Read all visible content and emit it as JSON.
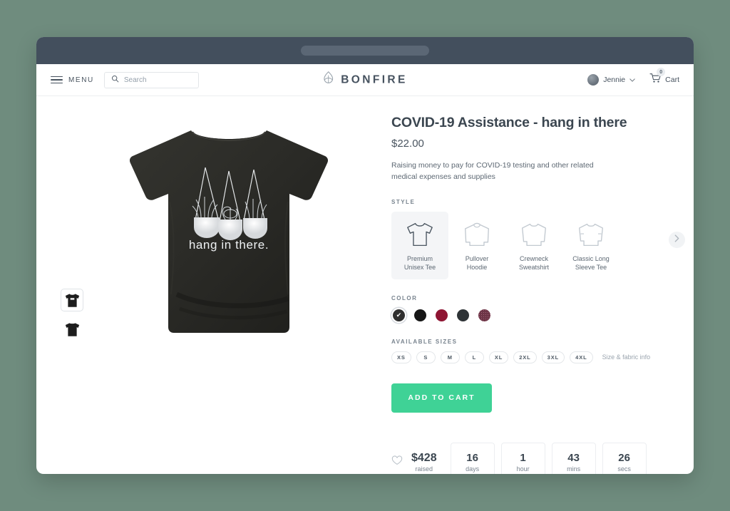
{
  "desktop": {
    "background_color": "#6f8c7e"
  },
  "browser": {
    "chrome_color": "#434f5c",
    "url": ""
  },
  "header": {
    "menu_label": "MENU",
    "menu_icon": "hamburger-icon",
    "search": {
      "placeholder": "Search",
      "value": "",
      "icon": "search-icon"
    },
    "brand": {
      "name": "BONFIRE",
      "logo_icon": "bonfire-flame-icon"
    },
    "user": {
      "name": "Jennie",
      "chevron": "⌄",
      "avatar_icon": "avatar-icon"
    },
    "cart": {
      "label": "Cart",
      "count": "0",
      "icon": "cart-icon"
    }
  },
  "gallery": {
    "thumbnails": [
      {
        "name": "front-view",
        "selected": true
      },
      {
        "name": "back-view",
        "selected": false
      }
    ],
    "hero": {
      "alt": "Black heather t-shirt with three hanging planters",
      "graphic_text": "hang in there.",
      "shirt_color": "#2b2b2b"
    }
  },
  "product": {
    "title": "COVID-19 Assistance - hang in there",
    "price": "$22.00",
    "description": "Raising money to pay for COVID-19 testing and other related medical expenses and supplies"
  },
  "style": {
    "label": "STYLE",
    "next_arrow": "›",
    "options": [
      {
        "line1": "Premium",
        "line2": "Unisex Tee",
        "icon": "tshirt-icon",
        "selected": true
      },
      {
        "line1": "Pullover",
        "line2": "Hoodie",
        "icon": "hoodie-icon",
        "selected": false
      },
      {
        "line1": "Crewneck",
        "line2": "Sweatshirt",
        "icon": "crewneck-icon",
        "selected": false
      },
      {
        "line1": "Classic Long",
        "line2": "Sleeve Tee",
        "icon": "longsleeve-icon",
        "selected": false
      }
    ]
  },
  "color": {
    "label": "COLOR",
    "check_glyph": "✔",
    "swatches": [
      {
        "name": "black-heather",
        "hex": "#2f2f2f",
        "selected": true
      },
      {
        "name": "black",
        "hex": "#161616",
        "selected": false
      },
      {
        "name": "maroon",
        "hex": "#8e1533",
        "selected": false
      },
      {
        "name": "dark-grey-heather",
        "hex": "#2e3336",
        "selected": false
      },
      {
        "name": "maroon-heather",
        "hex": "#6d3547",
        "selected": false
      }
    ]
  },
  "sizes": {
    "label": "AVAILABLE SIZES",
    "options": [
      "XS",
      "S",
      "M",
      "L",
      "XL",
      "2XL",
      "3XL",
      "4XL"
    ],
    "info_link": "Size & fabric info"
  },
  "actions": {
    "add_to_cart": "ADD TO CART",
    "accent_color": "#3fd296"
  },
  "stats": {
    "favorite_icon": "heart-icon",
    "raised": {
      "amount": "$428",
      "caption": "raised"
    },
    "countdown": [
      {
        "value": "16",
        "unit": "days"
      },
      {
        "value": "1",
        "unit": "hour"
      },
      {
        "value": "43",
        "unit": "mins"
      },
      {
        "value": "26",
        "unit": "secs"
      }
    ]
  }
}
